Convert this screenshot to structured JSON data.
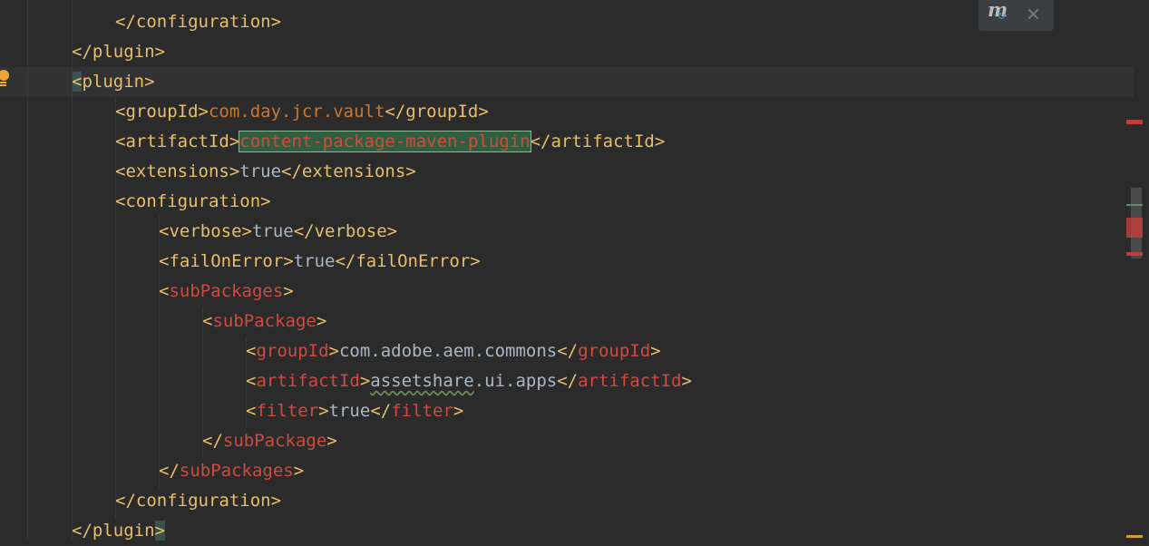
{
  "editor": {
    "lines": [
      {
        "indent": 2,
        "parts": [
          [
            "tag",
            "</configuration>"
          ]
        ]
      },
      {
        "indent": 1,
        "parts": [
          [
            "tag",
            "</plugin>"
          ]
        ]
      },
      {
        "indent": 1,
        "current": true,
        "parts": [
          [
            "brace",
            "<"
          ],
          [
            "tag",
            "plugin>"
          ]
        ]
      },
      {
        "indent": 2,
        "parts": [
          [
            "tag",
            "<groupId>"
          ],
          [
            "hl",
            "com.day.jcr.vault"
          ],
          [
            "tag",
            "</groupId>"
          ]
        ]
      },
      {
        "indent": 2,
        "parts": [
          [
            "tag",
            "<artifactId>"
          ],
          [
            "sel",
            "content-package-maven-plugin"
          ],
          [
            "tag",
            "</artifactId>"
          ]
        ]
      },
      {
        "indent": 2,
        "parts": [
          [
            "tag",
            "<extensions>"
          ],
          [
            "text",
            "true"
          ],
          [
            "tag",
            "</extensions>"
          ]
        ]
      },
      {
        "indent": 2,
        "parts": [
          [
            "tag",
            "<configuration>"
          ]
        ]
      },
      {
        "indent": 3,
        "parts": [
          [
            "tag",
            "<verbose>"
          ],
          [
            "text",
            "true"
          ],
          [
            "tag",
            "</verbose>"
          ]
        ]
      },
      {
        "indent": 3,
        "parts": [
          [
            "tag",
            "<failOnError>"
          ],
          [
            "text",
            "true"
          ],
          [
            "tag",
            "</failOnError>"
          ]
        ]
      },
      {
        "indent": 3,
        "parts": [
          [
            "tag",
            "<"
          ],
          [
            "red",
            "subPackages"
          ],
          [
            "tag",
            ">"
          ]
        ]
      },
      {
        "indent": 4,
        "parts": [
          [
            "tag",
            "<"
          ],
          [
            "red",
            "subPackage"
          ],
          [
            "tag",
            ">"
          ]
        ]
      },
      {
        "indent": 5,
        "parts": [
          [
            "tag",
            "<"
          ],
          [
            "red",
            "groupId"
          ],
          [
            "tag",
            ">"
          ],
          [
            "text",
            "com.adobe.aem.commons"
          ],
          [
            "tag",
            "</"
          ],
          [
            "red",
            "groupId"
          ],
          [
            "tag",
            ">"
          ]
        ]
      },
      {
        "indent": 5,
        "parts": [
          [
            "tag",
            "<"
          ],
          [
            "red",
            "artifactId"
          ],
          [
            "tag",
            ">"
          ],
          [
            "squig",
            "assetshare"
          ],
          [
            "text",
            ".ui.apps"
          ],
          [
            "tag",
            "</"
          ],
          [
            "red",
            "artifactId"
          ],
          [
            "tag",
            ">"
          ]
        ]
      },
      {
        "indent": 5,
        "parts": [
          [
            "tag",
            "<"
          ],
          [
            "red",
            "filter"
          ],
          [
            "tag",
            ">"
          ],
          [
            "text",
            "true"
          ],
          [
            "tag",
            "</"
          ],
          [
            "red",
            "filter"
          ],
          [
            "tag",
            ">"
          ]
        ]
      },
      {
        "indent": 4,
        "parts": [
          [
            "tag",
            "</"
          ],
          [
            "red",
            "subPackage"
          ],
          [
            "tag",
            ">"
          ]
        ]
      },
      {
        "indent": 3,
        "parts": [
          [
            "tag",
            "</"
          ],
          [
            "red",
            "subPackages"
          ],
          [
            "tag",
            ">"
          ]
        ]
      },
      {
        "indent": 2,
        "parts": [
          [
            "tag",
            "</configuration>"
          ]
        ]
      },
      {
        "indent": 1,
        "parts": [
          [
            "tag",
            "</plugin"
          ],
          [
            "brace",
            ">"
          ]
        ]
      }
    ]
  },
  "notification": {
    "icon": "maven-reload-icon",
    "close_icon": "close-icon"
  },
  "colors": {
    "background": "#2b2b2b",
    "current_line": "#323232",
    "tag": "#e8bf6a",
    "value": "#a9b7c6",
    "error_mark": "#bc3f3c"
  }
}
